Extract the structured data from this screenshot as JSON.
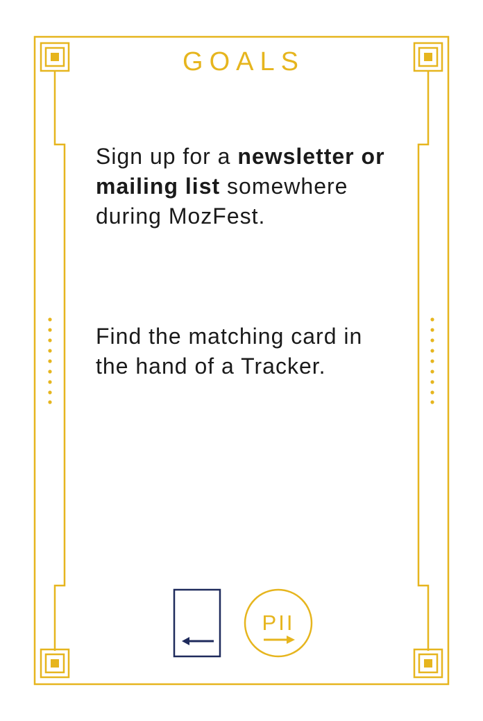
{
  "card": {
    "title": "GOALS",
    "goal": {
      "prefix": "Sign up for a ",
      "bold": "newsletter or mailing list",
      "suffix": " somewhere during MozFest."
    },
    "instruction": "Find the matching card in the hand of a Tracker."
  },
  "icons": {
    "card_icon": "card-with-left-arrow-icon",
    "pii_badge_label": "PII",
    "pii_icon": "pii-right-arrow-badge-icon"
  },
  "colors": {
    "accent": "#E6B51E",
    "navy": "#1E2A5C",
    "text": "#1a1a1a",
    "background": "#FFFFFF"
  }
}
